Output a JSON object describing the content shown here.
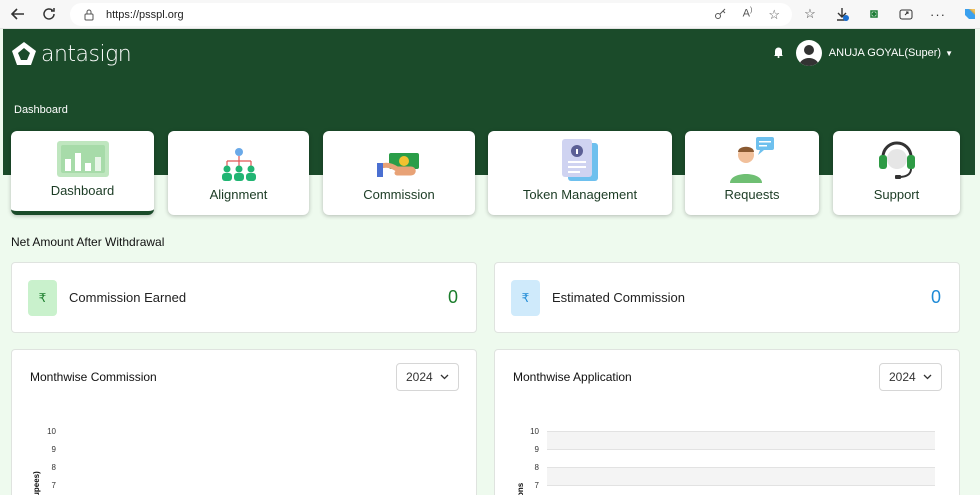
{
  "browser": {
    "url": "https://psspl.org"
  },
  "header": {
    "logo_text": "antasign",
    "user_name": "ANUJA GOYAL(Super)",
    "breadcrumb": "Dashboard"
  },
  "tiles": [
    {
      "label": "Dashboard"
    },
    {
      "label": "Alignment"
    },
    {
      "label": "Commission"
    },
    {
      "label": "Token Management"
    },
    {
      "label": "Requests"
    },
    {
      "label": "Support"
    }
  ],
  "section_title": "Net Amount After Withdrawal",
  "stats": {
    "commission_earned": {
      "icon": "₹",
      "label": "Commission Earned",
      "value": "0"
    },
    "estimated_commission": {
      "icon": "₹",
      "label": "Estimated Commission",
      "value": "0"
    }
  },
  "charts": {
    "monthwise_commission": {
      "title": "Monthwise Commission",
      "year": "2024",
      "ylabel": "upees)"
    },
    "monthwise_application": {
      "title": "Monthwise Application",
      "year": "2024",
      "ylabel": "ons"
    }
  },
  "chart_data": [
    {
      "type": "bar",
      "title": "Monthwise Commission",
      "ylabel": "upees)",
      "y_ticks": [
        "10",
        "9",
        "8",
        "7"
      ],
      "ylim": [
        7,
        10
      ]
    },
    {
      "type": "bar",
      "title": "Monthwise Application",
      "ylabel": "ons",
      "y_ticks": [
        "10",
        "9",
        "8",
        "7"
      ],
      "ylim": [
        7,
        10
      ]
    }
  ],
  "colors": {
    "header_green": "#1b4b2a",
    "value_green": "#1a7d2b",
    "value_blue": "#1e8ad6",
    "page_bg": "#eefaee"
  }
}
